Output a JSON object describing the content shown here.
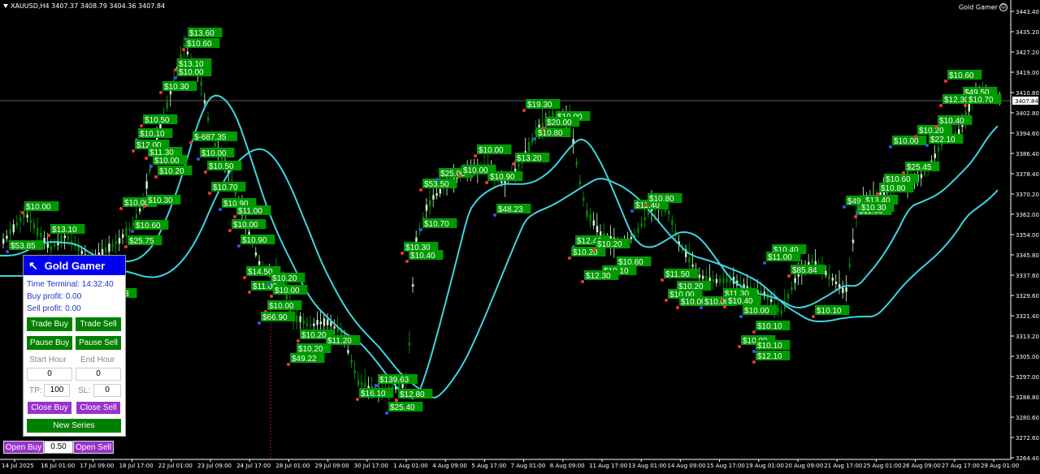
{
  "header": {
    "symbol": "XAUUSD,H4",
    "quotes": "3407.37 3408.79 3404.36 3407.84"
  },
  "ea_name": "Gold Gamer",
  "price_axis": [
    "3443.40",
    "3435.20",
    "3427.20",
    "3419.00",
    "3410.80",
    "3402.80",
    "3394.60",
    "3386.40",
    "3378.40",
    "3370.20",
    "3362.00",
    "3354.00",
    "3345.80",
    "3337.60",
    "3329.60",
    "3321.40",
    "3313.20",
    "3305.00",
    "3297.00",
    "3288.80",
    "3280.60",
    "3272.60",
    "3264.40"
  ],
  "current_price": "3407.84",
  "time_axis": [
    "14 Jul 2025",
    "16 Jul 01:00",
    "17 Jul 09:00",
    "18 Jul 17:00",
    "22 Jul 01:00",
    "23 Jul 09:00",
    "24 Jul 17:00",
    "28 Jul 01:00",
    "29 Jul 09:00",
    "30 Jul 17:00",
    "1 Aug 01:00",
    "4 Aug 09:00",
    "5 Aug 17:00",
    "7 Aug 01:00",
    "8 Aug 09:00",
    "11 Aug 17:00",
    "13 Aug 01:00",
    "14 Aug 09:00",
    "15 Aug 17:00",
    "19 Aug 01:00",
    "20 Aug 09:00",
    "21 Aug 17:00",
    "25 Aug 01:00",
    "26 Aug 09:00",
    "27 Aug 17:00",
    "29 Aug 01:00"
  ],
  "profit_labels": [
    {
      "t": "$13.60"
    },
    {
      "t": "$10.60"
    },
    {
      "t": "$13.10"
    },
    {
      "t": "$10.00"
    },
    {
      "t": "$10.30"
    },
    {
      "t": "$10.50"
    },
    {
      "t": "$10.10"
    },
    {
      "t": "$12.00"
    },
    {
      "t": "$11.30"
    },
    {
      "t": "$10.00"
    },
    {
      "t": "$10.20"
    },
    {
      "t": "$-687.35"
    },
    {
      "t": "$10.00"
    },
    {
      "t": "$10.50"
    },
    {
      "t": "$10.70"
    },
    {
      "t": "$10.90"
    },
    {
      "t": "$11.00"
    },
    {
      "t": "$10.00"
    },
    {
      "t": "$10.90"
    },
    {
      "t": "$14.50"
    },
    {
      "t": "$11.00"
    },
    {
      "t": "$10.20"
    },
    {
      "t": "$10.00"
    },
    {
      "t": "$10.00"
    },
    {
      "t": "$66.90"
    },
    {
      "t": "$10.20"
    },
    {
      "t": "$11.20"
    },
    {
      "t": "$10.20"
    },
    {
      "t": "$49.22"
    },
    {
      "t": "$10.00"
    },
    {
      "t": "$53.85"
    },
    {
      "t": "$13.10"
    },
    {
      "t": "$10.00"
    },
    {
      "t": "$10.60"
    },
    {
      "t": "$25.75"
    },
    {
      "t": "$10.30"
    },
    {
      "t": "$48.78"
    },
    {
      "t": "$11.70"
    },
    {
      "t": "$10.00"
    },
    {
      "t": "$139.63"
    },
    {
      "t": "$16.10"
    },
    {
      "t": "$12.80"
    },
    {
      "t": "$25.40"
    },
    {
      "t": "$10.30"
    },
    {
      "t": "$10.40"
    },
    {
      "t": "$10.70"
    },
    {
      "t": "$53.50"
    },
    {
      "t": "$10.00"
    },
    {
      "t": "$25.00"
    },
    {
      "t": "$10.00"
    },
    {
      "t": "$10.90"
    },
    {
      "t": "$48.23"
    },
    {
      "t": "$13.20"
    },
    {
      "t": "$19.30"
    },
    {
      "t": "$10.80"
    },
    {
      "t": "$10.00"
    },
    {
      "t": "$20.00"
    },
    {
      "t": "$12.40"
    },
    {
      "t": "$10.20"
    },
    {
      "t": "$10.20"
    },
    {
      "t": "$10.60"
    },
    {
      "t": "$10.10"
    },
    {
      "t": "$12.30"
    },
    {
      "t": "$11.40"
    },
    {
      "t": "$10.80"
    },
    {
      "t": "$11.50"
    },
    {
      "t": "$10.20"
    },
    {
      "t": "$10.00"
    },
    {
      "t": "$10.00"
    },
    {
      "t": "$10.00"
    },
    {
      "t": "$11.30"
    },
    {
      "t": "$10.40"
    },
    {
      "t": "$10.00"
    },
    {
      "t": "$10.10"
    },
    {
      "t": "$10.00"
    },
    {
      "t": "$10.10"
    },
    {
      "t": "$12.10"
    },
    {
      "t": "$10.40"
    },
    {
      "t": "$11.00"
    },
    {
      "t": "$85.84"
    },
    {
      "t": "$10.10"
    },
    {
      "t": "$49.30"
    },
    {
      "t": "$11.00"
    },
    {
      "t": "$13.40"
    },
    {
      "t": "$10.30"
    },
    {
      "t": "$10.60"
    },
    {
      "t": "$10.80"
    },
    {
      "t": "$10.00"
    },
    {
      "t": "$25.45"
    },
    {
      "t": "$10.20"
    },
    {
      "t": "$22.10"
    },
    {
      "t": "$10.40"
    },
    {
      "t": "$10.60"
    },
    {
      "t": "$49.50"
    },
    {
      "t": "$12.30"
    },
    {
      "t": "$10.70"
    }
  ],
  "panel": {
    "title": "Gold Gamer",
    "time_terminal": "Time Terminal: 14:32:40",
    "buy_profit": "Buy profit: 0.00",
    "sell_profit": "Sell profit: 0.00",
    "trade_buy": "Trade Buy",
    "trade_sell": "Trade Sell",
    "pause_buy": "Pause Buy",
    "pause_sell": "Pause Sell",
    "start_hour_label": "Start Hour",
    "end_hour_label": "End Hour",
    "start_hour": "0",
    "end_hour": "0",
    "tp_label": "TP:",
    "tp_value": "100",
    "sl_label": "SL:",
    "sl_value": "0",
    "close_buy": "Close Buy",
    "close_sell": "Close Sell",
    "new_series": "New Series"
  },
  "open_buy": "Open Buy",
  "lot": "0.50",
  "open_sell": "Open Sell",
  "colors": {
    "bg": "#000000",
    "bull": "#ccffcc",
    "bear": "#00aa00",
    "ma": "#40e0e0",
    "label_bg": "#009900"
  }
}
